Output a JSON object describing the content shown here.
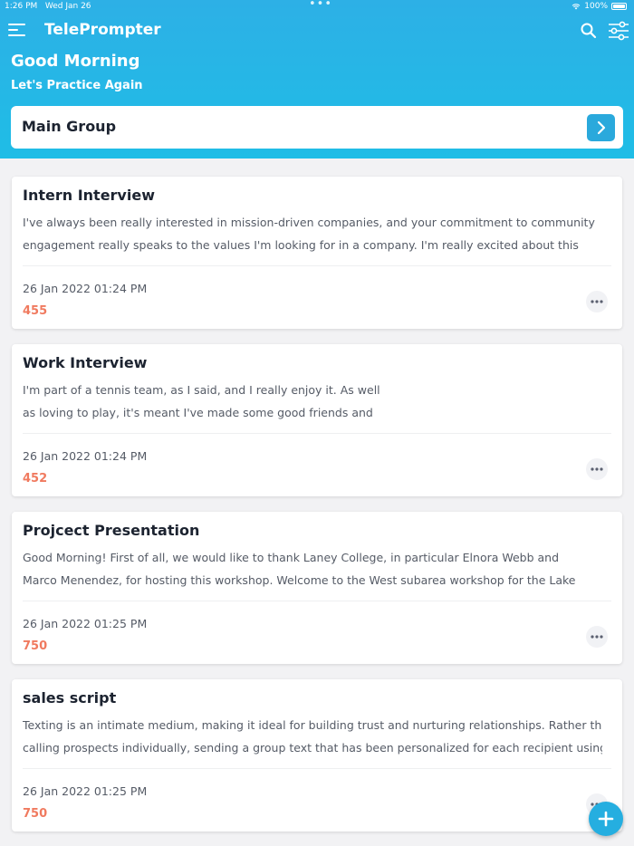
{
  "status_bar": {
    "time": "1:26 PM",
    "date": "Wed Jan 26",
    "multitask_dots": "•••",
    "battery": "100%"
  },
  "topbar": {
    "menu_icon": "hamburger-menu-icon",
    "title": "TelePrompter",
    "search_icon": "search-icon",
    "filter_icon": "sliders-icon"
  },
  "greeting": {
    "title": "Good Morning",
    "subtitle": "Let's Practice Again"
  },
  "group": {
    "label": "Main Group",
    "icon": "chevron-right-icon"
  },
  "scripts": [
    {
      "title": "Intern Interview",
      "preview_lines": [
        "I've always been really interested in mission-driven companies, and your commitment to community",
        "engagement really speaks to the values I'm looking for in a company. I'm really excited about this"
      ],
      "date": "26 Jan 2022 01:24 PM",
      "count": "455"
    },
    {
      "title": "Work Interview",
      "preview_lines": [
        "I'm part of a tennis team, as I said, and I really enjoy it. As well",
        "as loving to play, it's meant I've made some good friends and"
      ],
      "date": "26 Jan 2022 01:24 PM",
      "count": "452"
    },
    {
      "title": "Projcect Presentation",
      "preview_lines": [
        "Good Morning! First of all, we would like to thank Laney College, in particular Elnora Webb and",
        "Marco Menendez, for hosting this workshop. Welcome to the West subarea workshop for the Lake"
      ],
      "date": "26 Jan 2022 01:25 PM",
      "count": "750"
    },
    {
      "title": "sales script",
      "preview_lines": [
        "Texting is an intimate medium, making it ideal for building trust and nurturing relationships. Rather than",
        "calling prospects individually, sending a group text that has been personalized for each recipient using"
      ],
      "date": "26 Jan 2022 01:25 PM",
      "count": "750"
    }
  ],
  "fab": {
    "icon": "plus-icon"
  },
  "colors": {
    "header": "#2db0e6",
    "accent": "#2aa9dc",
    "count": "#f07a5f",
    "background": "#f2f2f4"
  }
}
